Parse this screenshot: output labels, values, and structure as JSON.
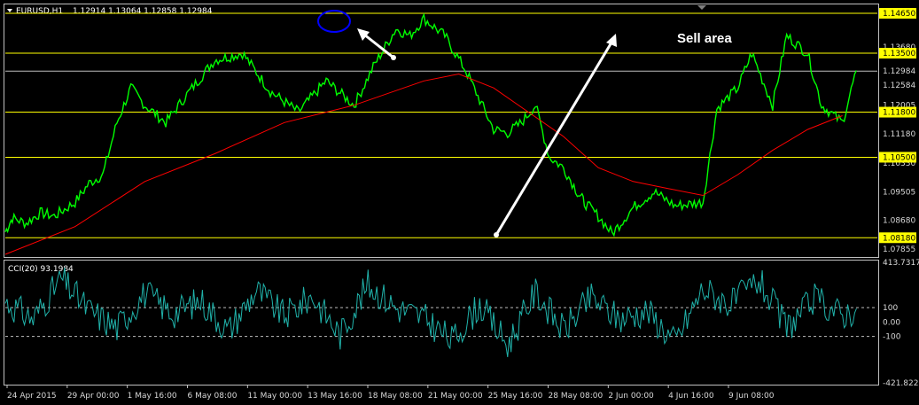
{
  "header": {
    "symbol": "EURUSD,H1",
    "quote": "1.12914 1.13064 1.12858 1.12984"
  },
  "annotation": "Sell area",
  "colors": {
    "background": "#000000",
    "frame": "#c0c0c0",
    "price": "#00ff00",
    "ma": "#ff0000",
    "cci": "#20b2aa",
    "levels": "#ffff00",
    "level_tag_bg": "#ffff00",
    "arrows": "#ffffff",
    "marker": "#0000ff"
  },
  "chart_data": [
    {
      "type": "line",
      "title": "EURUSD,H1",
      "price_axis_ticks": [
        1.1368,
        1.12584,
        1.12005,
        1.1118,
        1.1033,
        1.09505,
        1.0868,
        1.07855
      ],
      "levels": [
        1.1465,
        1.135,
        1.118,
        1.105,
        1.0818
      ],
      "last_price": 1.12984,
      "x_labels": [
        "24 Apr 2015",
        "29 Apr 00:00",
        "1 May 16:00",
        "6 May 08:00",
        "11 May 00:00",
        "13 May 16:00",
        "18 May 08:00",
        "21 May 00:00",
        "25 May 16:00",
        "28 May 08:00",
        "2 Jun 00:00",
        "4 Jun 16:00",
        "9 Jun 08:00"
      ],
      "ylim": [
        1.0765,
        1.1488
      ],
      "series": [
        {
          "name": "EURUSD,H1",
          "x": [
            0,
            0.1,
            0.3,
            0.5,
            0.7,
            1.0,
            1.2,
            1.4,
            1.6,
            1.8,
            2.0,
            2.3,
            2.6,
            3.0,
            3.4,
            3.8,
            4.2,
            4.6,
            5.0,
            5.3,
            5.6,
            5.8,
            6.0,
            6.3,
            6.6,
            7.0,
            7.2,
            7.4,
            7.6,
            7.8,
            8.0,
            8.2,
            8.3,
            8.5,
            8.7,
            9.0,
            9.3,
            9.6,
            10.0,
            10.2,
            10.5,
            10.7,
            11.0,
            11.2,
            11.5,
            11.7,
            12.0,
            12.2
          ],
          "values": [
            1.0835,
            1.0875,
            1.086,
            1.089,
            1.088,
            1.092,
            1.0975,
            1.1,
            1.115,
            1.125,
            1.12,
            1.115,
            1.123,
            1.133,
            1.135,
            1.124,
            1.118,
            1.127,
            1.12,
            1.132,
            1.142,
            1.14,
            1.145,
            1.14,
            1.13,
            1.113,
            1.112,
            1.115,
            1.12,
            1.105,
            1.102,
            1.095,
            1.092,
            1.088,
            1.083,
            1.0905,
            1.095,
            1.091,
            1.092,
            1.119,
            1.125,
            1.135,
            1.12,
            1.14,
            1.135,
            1.12,
            1.115,
            1.13
          ]
        },
        {
          "name": "MA",
          "x": [
            0,
            1,
            2,
            3,
            4,
            5,
            6,
            6.5,
            7,
            7.5,
            8,
            8.5,
            9,
            9.5,
            10,
            10.5,
            11,
            11.5,
            12
          ],
          "values": [
            1.077,
            1.085,
            1.098,
            1.106,
            1.115,
            1.12,
            1.127,
            1.129,
            1.125,
            1.118,
            1.111,
            1.102,
            1.098,
            1.096,
            1.094,
            1.1,
            1.107,
            1.113,
            1.117
          ]
        }
      ]
    },
    {
      "type": "line",
      "title": "CCI(20) 93.1984",
      "y_ticks": [
        413.7317,
        100,
        0.0,
        -100,
        -421.8225
      ],
      "ylim": [
        -421.8225,
        413.7317
      ],
      "series": [
        {
          "name": "CCI(20)",
          "x": [
            0,
            0.4,
            0.8,
            1.2,
            1.6,
            2.0,
            2.4,
            2.8,
            3.2,
            3.6,
            4.0,
            4.4,
            4.8,
            5.2,
            5.6,
            6.0,
            6.4,
            6.8,
            7.2,
            7.6,
            8.0,
            8.4,
            8.8,
            9.2,
            9.6,
            10.0,
            10.4,
            10.8,
            11.2,
            11.6,
            12.0,
            12.2
          ],
          "values": [
            140,
            20,
            300,
            80,
            -40,
            200,
            60,
            150,
            -60,
            220,
            40,
            180,
            -90,
            260,
            100,
            30,
            -130,
            120,
            -160,
            210,
            -60,
            170,
            20,
            80,
            -140,
            230,
            120,
            290,
            -40,
            160,
            50,
            93.1984
          ]
        }
      ]
    }
  ]
}
